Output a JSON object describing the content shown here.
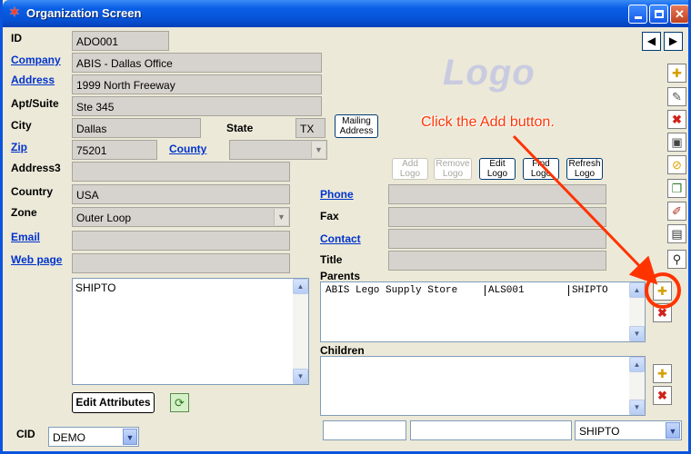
{
  "window": {
    "title": "Organization Screen"
  },
  "labels": {
    "id": "ID",
    "company": "Company",
    "address": "Address",
    "apt": "Apt/Suite",
    "city": "City",
    "state": "State",
    "zip": "Zip",
    "county": "County",
    "address3": "Address3",
    "country": "Country",
    "zone": "Zone",
    "email": "Email",
    "webpage": "Web page",
    "phone": "Phone",
    "fax": "Fax",
    "contact": "Contact",
    "title": "Title",
    "parents": "Parents",
    "children": "Children",
    "cid": "CID"
  },
  "fields": {
    "id": "ADO001",
    "company": "ABIS - Dallas Office",
    "address": "1999 North Freeway",
    "apt": "Ste 345",
    "city": "Dallas",
    "state": "TX",
    "zip": "75201",
    "county": "",
    "address3": "",
    "country": "USA",
    "zone": "Outer Loop",
    "email": "",
    "webpage": "",
    "phone": "",
    "fax": "",
    "contact": "",
    "title": "",
    "notes": "SHIPTO",
    "cid": "DEMO",
    "bottom1": "",
    "bottom2": "",
    "bottom_type": "SHIPTO"
  },
  "buttons": {
    "mailing_1": "Mailing",
    "mailing_2": "Address",
    "add_logo_1": "Add",
    "add_logo_2": "Logo",
    "remove_logo_1": "Remove",
    "remove_logo_2": "Logo",
    "edit_logo_1": "Edit",
    "edit_logo_2": "Logo",
    "find_logo_1": "Find",
    "find_logo_2": "Logo",
    "refresh_logo_1": "Refresh",
    "refresh_logo_2": "Logo",
    "edit_attributes": "Edit Attributes"
  },
  "logo_placeholder": "Logo",
  "parents": [
    {
      "name": "ABIS Lego Supply Store",
      "code": "ALS001",
      "type": "SHIPTO"
    }
  ],
  "callout": "Click the Add button.",
  "colors": {
    "callout": "#ff3300",
    "title_bar": "#0a5fe6"
  }
}
